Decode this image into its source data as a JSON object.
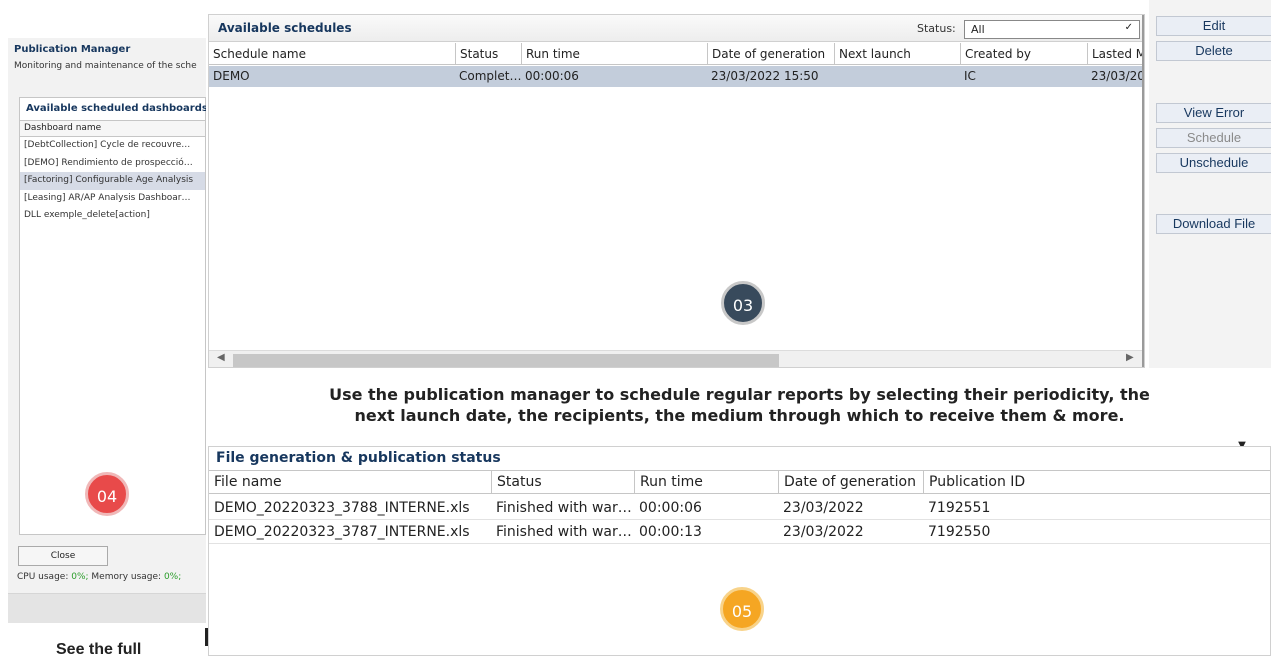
{
  "left": {
    "title": "Publication Manager",
    "subtitle": "Monitoring and maintenance of the sche",
    "box_title": "Available scheduled dashboards",
    "column": "Dashboard name",
    "items": [
      "[DebtCollection] Cycle de recouvre…",
      "[DEMO] Rendimiento de prospecció…",
      "[Factoring] Configurable Age Analysis",
      "[Leasing] AR/AP Analysis Dashboar…",
      "DLL exemple_delete[action]"
    ],
    "close_label": "Close",
    "cpu_label": "CPU usage:",
    "cpu_value": "0%;",
    "mem_label": "Memory usage:",
    "mem_value": "0%;",
    "see_full": "See the full"
  },
  "schedules": {
    "title": "Available schedules",
    "status_label": "Status:",
    "status_value": "All",
    "columns": [
      "Schedule name",
      "Status",
      "Run time",
      "Date of generation",
      "Next launch",
      "Created by",
      "Lasted M"
    ],
    "rows": [
      [
        "DEMO",
        "Complet…",
        "00:00:06",
        "23/03/2022 15:50",
        "",
        "IC",
        "23/03/20"
      ]
    ]
  },
  "buttons": {
    "edit": "Edit",
    "delete": "Delete",
    "view_error": "View Error",
    "schedule": "Schedule",
    "unschedule": "Unschedule",
    "download": "Download File"
  },
  "badges": {
    "b03": "03",
    "b04": "04",
    "b05": "05"
  },
  "caption": {
    "line1": "Use the publication manager to schedule regular reports by selecting their periodicity, the",
    "line2": "next launch date, the recipients, the medium through which to receive them & more."
  },
  "files": {
    "title": "File generation & publication status",
    "columns": [
      "File name",
      "Status",
      "Run time",
      "Date of generation",
      "Publication ID"
    ],
    "rows": [
      [
        "DEMO_20220323_3788_INTERNE.xls",
        "Finished with war…",
        "00:00:06",
        "23/03/2022",
        "7192551"
      ],
      [
        "DEMO_20220323_3787_INTERNE.xls",
        "Finished with war…",
        "00:00:13",
        "23/03/2022",
        "7192550"
      ]
    ]
  }
}
